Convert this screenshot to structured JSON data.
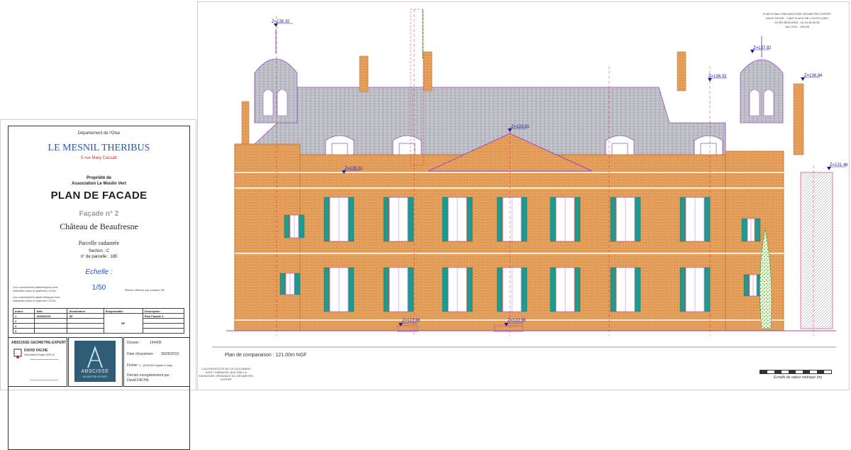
{
  "cartouche": {
    "department": "Département de l'Oise",
    "town": "LE MESNIL THERIBUS",
    "address": "5 rue Mary Cassatt",
    "owner_line1": "Propriété de",
    "owner_line2": "Association Le Moulin Vert",
    "plan_title": "PLAN DE FACADE",
    "facade": "Façade n° 2",
    "building": "Château de Beaufresne",
    "parcel_heading": "Parcelle cadastrée",
    "section": "Section : C",
    "parcel_number": "n° de parcelle : 180",
    "scale_label": "Echelle :",
    "scale_value": "1/50",
    "coords_note1": "Les coordonnées altimétriques sont indiquées dans le système LOCAL",
    "coords_note2": "Les coordonnées planimétriques sont indiquées dans le système LOCAL",
    "survey_note": "Relevé effectué par scanner 3D",
    "table_headers": [
      "Indice",
      "Date",
      "Dessinateur",
      "Responsable",
      "Description"
    ],
    "table_rows": [
      [
        "1",
        "30/05/2019",
        "SF",
        "",
        "Plan Façade 2"
      ],
      [
        "2",
        "",
        "",
        "",
        ""
      ],
      [
        "3",
        "",
        "",
        "",
        ""
      ],
      [
        "4",
        "",
        "",
        "",
        ""
      ]
    ],
    "table_resp_initials": "RF"
  },
  "bottom_block": {
    "firm_title": "ABSCISSE GEOMETRE-EXPERT",
    "firm_name": "DAVID FACHE",
    "firm_sub": "Géomètre-Expert DPLG",
    "logo_text": "ABSCISSE",
    "logo_sub": "GEOMETRE-EXPERT",
    "dossier_label": "Dossier :",
    "dossier_value": "194436",
    "opening_label": "Date d'ouverture :",
    "opening_value": "30/05/2019",
    "file_label": "Fichier :",
    "file_value": "[...]194436-Façade-2.dwg",
    "record_label": "Dernier enregistrement par :",
    "record_value": "David FACHE"
  },
  "drawing": {
    "header_line1": "PLAN ETABLI PAR ABSCISSE GEOMETRE-EXPERT",
    "header_line2": "DAVID FACHE - 10b/2 PLACE DE L'HOTEL DIEU",
    "header_line3": "60 000 BEAUVAIS - 03.44.48.05.66",
    "header_line4": "Juin 2019 - 194436",
    "comparison_plane": "Plan de comparaison : 121.00m NGF",
    "scale_bar_label": "Echelle de valeur métrique (m)",
    "legal_note": "L'AUTHENTICITÉ DE CE DOCUMENT N'EST GARANTIE QUE PAR LA SIGNATURE ORIGINALE DU GÉOMÈTRE-EXPERT",
    "elevations": [
      "Z=136.32",
      "Z=137.92",
      "Z=136.32",
      "Z=136.84",
      "Z=133.81",
      "Z=135.01",
      "Z=131.46",
      "Z=122.86",
      "Z=122.88"
    ]
  },
  "colors": {
    "brick": "#e9a35b",
    "roof": "#bfc0c6",
    "shutter": "#1f9a8e",
    "annotation": "#1a1aa8",
    "dimension": "#e0245e",
    "outline": "#9b47c9",
    "logo_bg": "#2f5c76"
  }
}
